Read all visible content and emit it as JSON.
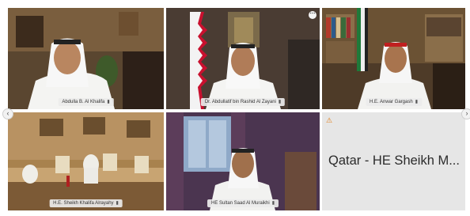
{
  "participants": [
    {
      "name": "Abdulla B. Al Khalifa",
      "mic_icon": "mic-icon"
    },
    {
      "name": "Dr. Abdullatif bin Rashid Al Zayani",
      "mic_icon": "mic-icon"
    },
    {
      "name": "H.E. Anwar Gargash",
      "mic_icon": "mic-icon"
    },
    {
      "name": "H.E. Sheikh Khalifa Alrayahy",
      "mic_icon": "mic-icon"
    },
    {
      "name": "HE Sultan Saad Al Muraikhi",
      "mic_icon": "mic-icon"
    }
  ],
  "text_tile": {
    "name": "Qatar - HE Sheikh M...",
    "icon": "warning-icon"
  },
  "controls": {
    "more_icon": "more-options-icon",
    "prev_icon": "chevron-left-icon",
    "next_icon": "chevron-right-icon"
  }
}
